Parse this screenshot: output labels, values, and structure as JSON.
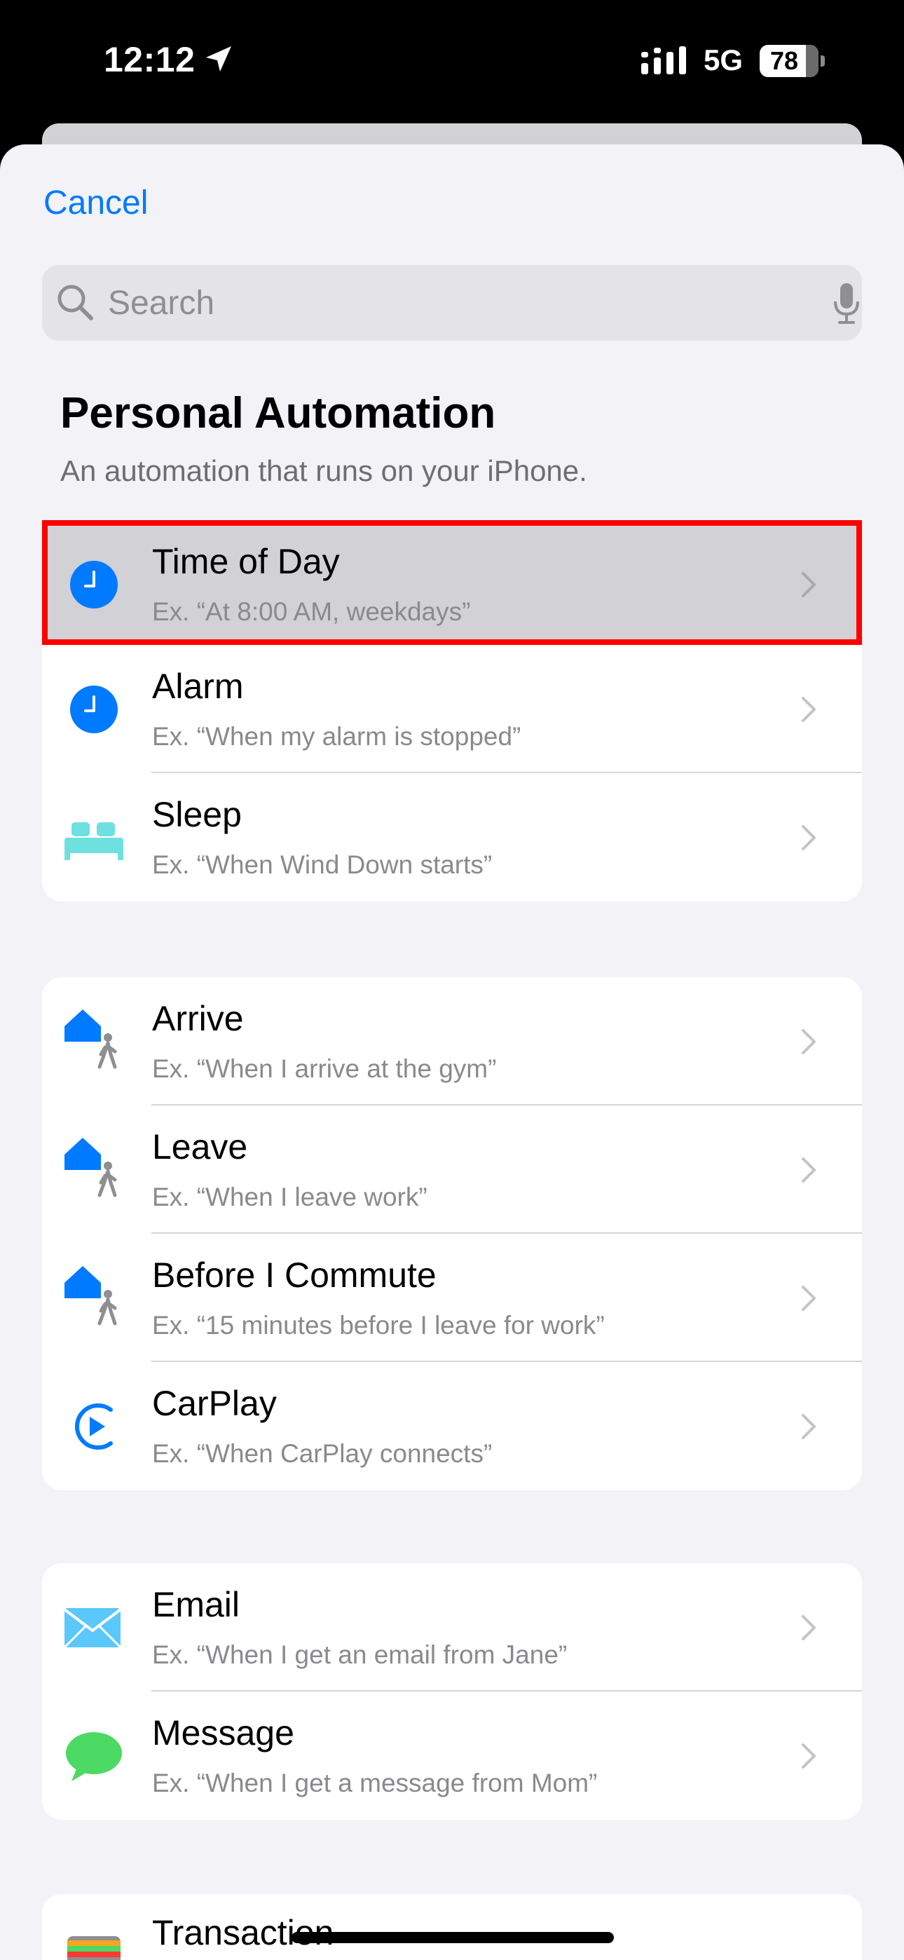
{
  "status_bar": {
    "time": "12:12",
    "network": "5G",
    "battery": "78"
  },
  "sheet": {
    "cancel_label": "Cancel",
    "search_placeholder": "Search",
    "title": "Personal Automation",
    "subtitle": "An automation that runs on your iPhone."
  },
  "highlighted_item": {
    "title": "Time of Day",
    "subtitle": "Ex. “At 8:00 AM, weekdays”",
    "icon": "clock-icon"
  },
  "groups": [
    {
      "items": [
        {
          "title": "Alarm",
          "subtitle": "Ex. “When my alarm is stopped”",
          "icon": "alarm-clock-icon"
        },
        {
          "title": "Sleep",
          "subtitle": "Ex. “When Wind Down starts”",
          "icon": "bed-icon"
        }
      ]
    },
    {
      "items": [
        {
          "title": "Arrive",
          "subtitle": "Ex. “When I arrive at the gym”",
          "icon": "home-person-icon"
        },
        {
          "title": "Leave",
          "subtitle": "Ex. “When I leave work”",
          "icon": "home-person-icon"
        },
        {
          "title": "Before I Commute",
          "subtitle": "Ex. “15 minutes before I leave for work”",
          "icon": "home-person-icon"
        },
        {
          "title": "CarPlay",
          "subtitle": "Ex. “When CarPlay connects”",
          "icon": "carplay-icon"
        }
      ]
    },
    {
      "items": [
        {
          "title": "Email",
          "subtitle": "Ex. “When I get an email from Jane”",
          "icon": "mail-icon"
        },
        {
          "title": "Message",
          "subtitle": "Ex. “When I get a message from Mom”",
          "icon": "message-bubble-icon"
        }
      ]
    },
    {
      "items": [
        {
          "title": "Transaction",
          "icon": "wallet-icon"
        }
      ]
    }
  ],
  "colors": {
    "accent": "#007aff",
    "highlight_border": "#ff0000",
    "sleep_icon": "#6ee0e0",
    "message_icon": "#4cd964"
  }
}
